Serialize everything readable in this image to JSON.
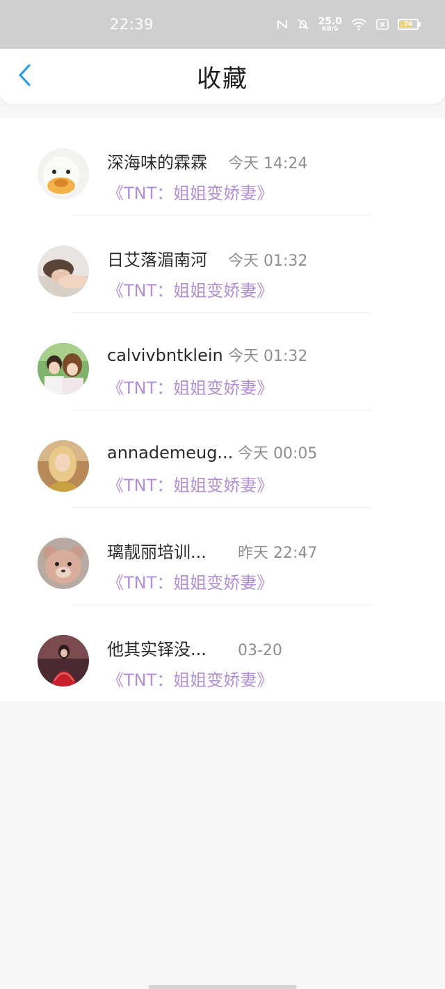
{
  "status_bar": {
    "time": "22:39",
    "net_speed_value": "25.0",
    "net_speed_unit": "KB/S",
    "battery_level": "74",
    "icons": [
      "nfc-icon",
      "mute-icon",
      "wifi-icon",
      "no-sim-icon",
      "battery-icon"
    ],
    "battery_color": "#f3d37a"
  },
  "nav": {
    "title": "收藏",
    "back_icon": "chevron-left-icon",
    "accent_color": "#2f9ee8"
  },
  "favorites": [
    {
      "name": "深海味的霖霖",
      "time": "今天 14:24",
      "book": "《TNT：姐姐变娇妻》",
      "avatar": "duck-avatar"
    },
    {
      "name": "日艾落湄南河",
      "time": "今天 01:32",
      "book": "《TNT：姐姐变娇妻》",
      "avatar": "resting-person-avatar"
    },
    {
      "name": "calvivbntklein",
      "time": "今天 01:32",
      "book": "《TNT：姐姐变娇妻》",
      "avatar": "couple-avatar"
    },
    {
      "name": "annademeug...",
      "time": "今天 00:05",
      "book": "《TNT：姐姐变娇妻》",
      "avatar": "blonde-girl-avatar"
    },
    {
      "name": "璃靓丽培训...",
      "time": "昨天 22:47",
      "book": "《TNT：姐姐变娇妻》",
      "avatar": "teddy-bear-avatar"
    },
    {
      "name": "他其实铎没...",
      "time": "03-20",
      "book": "《TNT：姐姐变娇妻》",
      "avatar": "red-dress-avatar"
    }
  ],
  "colors": {
    "book_link": "#b48fd4",
    "time_text": "#8e8e8e",
    "status_bar_bg": "#cfcfcf"
  }
}
